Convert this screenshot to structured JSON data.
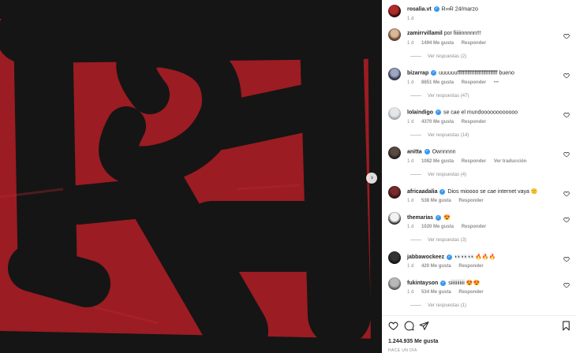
{
  "post": {
    "username": "rosalia.vt",
    "caption": "R∞R 24/marzo",
    "time_ago": "1 d",
    "likes": "1.244.935 Me gusta",
    "posted_when": "HACE UN DÍA"
  },
  "media": {
    "colors": {
      "background": "#9b1c22",
      "paint": "#151515"
    },
    "next_icon": "chevron-right-icon"
  },
  "comments": [
    {
      "username": "zamirrvillamil",
      "verified": false,
      "text": "por fiiiiinnnnn!!!",
      "time": "1 d",
      "likes": "1494 Me gusta",
      "reply": "Responder",
      "replies": "Ver respuestas (2)"
    },
    {
      "username": "bizarrap",
      "verified": true,
      "text": "uuuuuuffffffffffffffffffffffffffff bueno",
      "time": "1 d",
      "likes": "8851 Me gusta",
      "reply": "Responder",
      "more": "•••",
      "replies": "Ver respuestas (47)"
    },
    {
      "username": "lolaindigo",
      "verified": true,
      "text": "se cae el mundoooooooooooo",
      "time": "1 d",
      "likes": "4370 Me gusta",
      "reply": "Responder",
      "replies": "Ver respuestas (14)"
    },
    {
      "username": "anitta",
      "verified": true,
      "text": "Ownnnnn",
      "time": "1 d",
      "likes": "1082 Me gusta",
      "reply": "Responder",
      "translate": "Ver traducción",
      "replies": "Ver respuestas (4)"
    },
    {
      "username": "africaadalia",
      "verified": true,
      "text": "Dios mioooo se cae internet vaya 🙁",
      "time": "1 d",
      "likes": "538 Me gusta",
      "reply": "Responder"
    },
    {
      "username": "themarias",
      "verified": true,
      "text": "😍",
      "time": "1 d",
      "likes": "1020 Me gusta",
      "reply": "Responder",
      "replies": "Ver respuestas (3)"
    },
    {
      "username": "jabbawockeez",
      "verified": true,
      "text": "👀👀👀🔥🔥🔥",
      "time": "1 d",
      "likes": "420 Me gusta",
      "reply": "Responder"
    },
    {
      "username": "fukintayson",
      "verified": true,
      "text": "siiiiiiiiiii 😍😍",
      "time": "1 d",
      "likes": "534 Me gusta",
      "reply": "Responder",
      "replies": "Ver respuestas (1)"
    }
  ],
  "icons": {
    "like": "heart-icon",
    "comment": "comment-icon",
    "share": "share-icon",
    "save": "bookmark-icon"
  }
}
